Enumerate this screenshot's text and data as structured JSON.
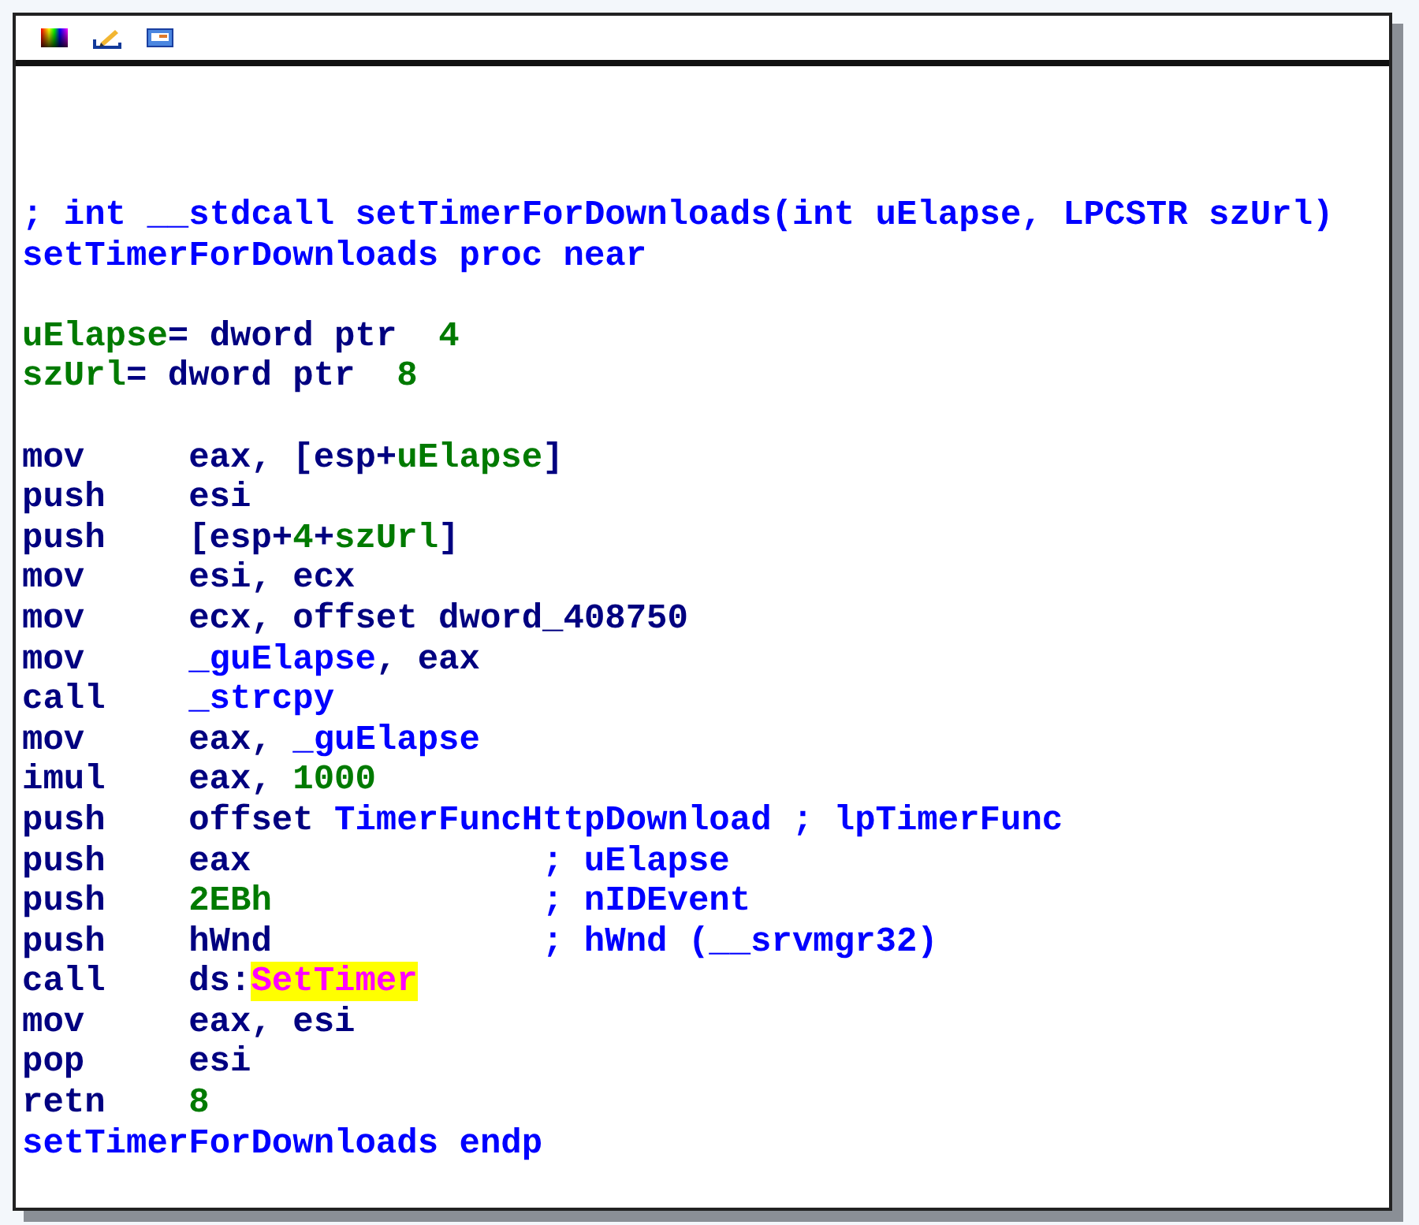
{
  "lines": [
    {
      "kind": "text",
      "segments": [
        {
          "text": "; int __stdcall setTimerForDownloads(int uElapse, LPCSTR szUrl)",
          "kind": "name"
        }
      ]
    },
    {
      "kind": "text",
      "segments": [
        {
          "text": "setTimerForDownloads proc near",
          "kind": "name"
        }
      ]
    },
    {
      "kind": "blank"
    },
    {
      "kind": "text",
      "segments": [
        {
          "text": "uElapse",
          "kind": "var"
        },
        {
          "text": "= dword ptr  ",
          "kind": "plain"
        },
        {
          "text": "4",
          "kind": "var"
        }
      ]
    },
    {
      "kind": "text",
      "segments": [
        {
          "text": "szUrl",
          "kind": "var"
        },
        {
          "text": "= dword ptr  ",
          "kind": "plain"
        },
        {
          "text": "8",
          "kind": "var"
        }
      ]
    },
    {
      "kind": "blank"
    },
    {
      "kind": "instr",
      "mnemonic": "mov",
      "operands": [
        {
          "text": "eax, [esp+",
          "kind": "plain"
        },
        {
          "text": "uElapse",
          "kind": "var"
        },
        {
          "text": "]",
          "kind": "plain"
        }
      ]
    },
    {
      "kind": "instr",
      "mnemonic": "push",
      "operands": [
        {
          "text": "esi",
          "kind": "plain"
        }
      ]
    },
    {
      "kind": "instr",
      "mnemonic": "push",
      "operands": [
        {
          "text": "[esp+",
          "kind": "plain"
        },
        {
          "text": "4",
          "kind": "var"
        },
        {
          "text": "+",
          "kind": "plain"
        },
        {
          "text": "szUrl",
          "kind": "var"
        },
        {
          "text": "]",
          "kind": "plain"
        }
      ]
    },
    {
      "kind": "instr",
      "mnemonic": "mov",
      "operands": [
        {
          "text": "esi, ecx",
          "kind": "plain"
        }
      ]
    },
    {
      "kind": "instr",
      "mnemonic": "mov",
      "operands": [
        {
          "text": "ecx, offset dword_408750",
          "kind": "plain"
        }
      ]
    },
    {
      "kind": "instr",
      "mnemonic": "mov",
      "operands": [
        {
          "text": "_guElapse",
          "kind": "name"
        },
        {
          "text": ", eax",
          "kind": "plain"
        }
      ]
    },
    {
      "kind": "instr",
      "mnemonic": "call",
      "operands": [
        {
          "text": "_strcpy",
          "kind": "name"
        }
      ]
    },
    {
      "kind": "instr",
      "mnemonic": "mov",
      "operands": [
        {
          "text": "eax, ",
          "kind": "plain"
        },
        {
          "text": "_guElapse",
          "kind": "name"
        }
      ]
    },
    {
      "kind": "instr",
      "mnemonic": "imul",
      "operands": [
        {
          "text": "eax, ",
          "kind": "plain"
        },
        {
          "text": "1000",
          "kind": "var"
        }
      ]
    },
    {
      "kind": "instr",
      "mnemonic": "push",
      "operands": [
        {
          "text": "offset ",
          "kind": "plain"
        },
        {
          "text": "TimerFuncHttpDownload",
          "kind": "name"
        }
      ],
      "comment": "; lpTimerFunc"
    },
    {
      "kind": "instr",
      "mnemonic": "push",
      "operands": [
        {
          "text": "eax",
          "kind": "plain"
        }
      ],
      "comment": "; uElapse"
    },
    {
      "kind": "instr",
      "mnemonic": "push",
      "operands": [
        {
          "text": "2EBh",
          "kind": "var"
        }
      ],
      "comment": "; nIDEvent"
    },
    {
      "kind": "instr",
      "mnemonic": "push",
      "operands": [
        {
          "text": "hWnd",
          "kind": "plain"
        }
      ],
      "comment": "; hWnd (__srvmgr32)"
    },
    {
      "kind": "instr",
      "mnemonic": "call",
      "operands": [
        {
          "text": "ds:",
          "kind": "plain"
        },
        {
          "text": "SetTimer",
          "kind": "highlight"
        }
      ]
    },
    {
      "kind": "instr",
      "mnemonic": "mov",
      "operands": [
        {
          "text": "eax, esi",
          "kind": "plain"
        }
      ]
    },
    {
      "kind": "instr",
      "mnemonic": "pop",
      "operands": [
        {
          "text": "esi",
          "kind": "plain"
        }
      ]
    },
    {
      "kind": "instr",
      "mnemonic": "retn",
      "operands": [
        {
          "text": "8",
          "kind": "var"
        }
      ]
    },
    {
      "kind": "text",
      "segments": [
        {
          "text": "setTimerForDownloads endp",
          "kind": "name"
        }
      ]
    }
  ]
}
